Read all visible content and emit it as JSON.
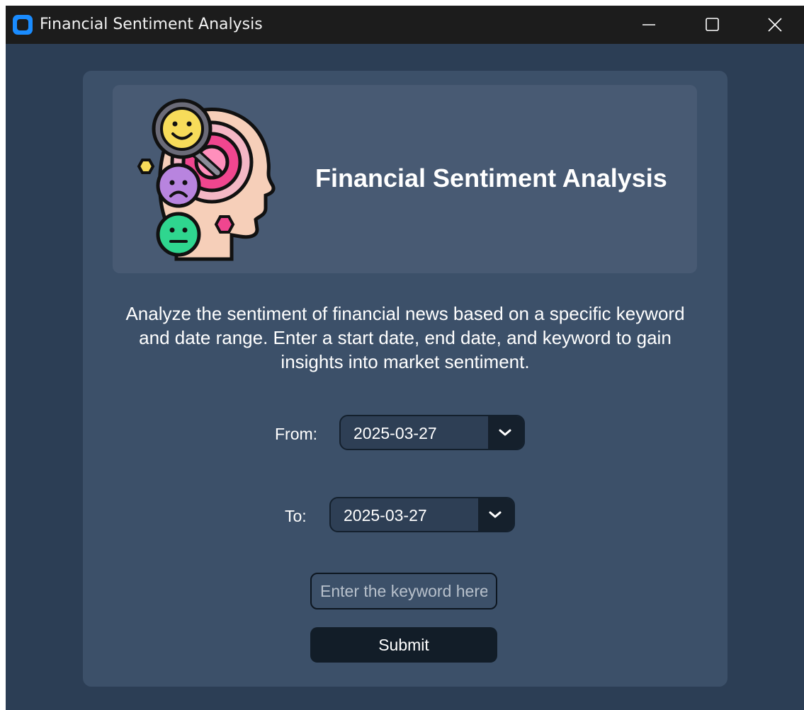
{
  "window": {
    "title": "Financial Sentiment Analysis",
    "app_icon": "app-logo-icon",
    "controls": {
      "minimize_icon": "minimize-icon",
      "maximize_icon": "maximize-icon",
      "close_icon": "close-icon"
    }
  },
  "header": {
    "logo_icon": "sentiment-head-illustration",
    "title": "Financial Sentiment Analysis"
  },
  "description": "Analyze the sentiment of financial news based on a specific keyword and date range. Enter a start date, end date, and keyword to gain insights into market sentiment.",
  "from_date": {
    "label": "From:",
    "value": "2025-03-27",
    "dropdown_icon": "chevron-down-icon"
  },
  "to_date": {
    "label": "To:",
    "value": "2025-03-27",
    "dropdown_icon": "chevron-down-icon"
  },
  "keyword": {
    "placeholder": "Enter the keyword here",
    "value": ""
  },
  "submit_label": "Submit",
  "colors": {
    "window_bg": "#2c3e55",
    "card_bg": "#3c5069",
    "header_bg": "#485a73",
    "titlebar_bg": "#1c1c1c",
    "accent": "#1a8cff"
  }
}
